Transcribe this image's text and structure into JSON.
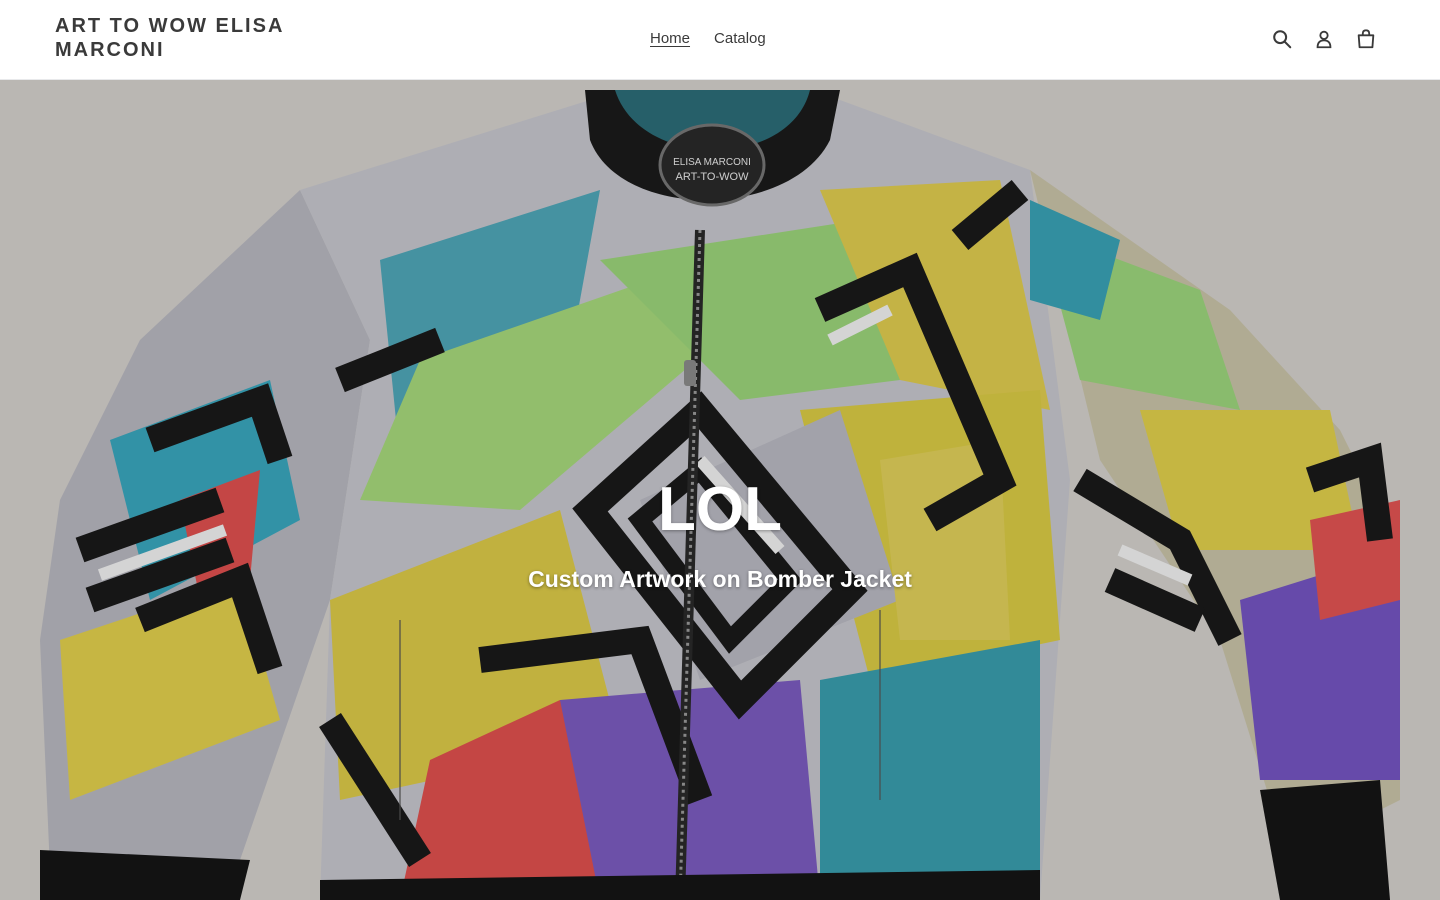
{
  "header": {
    "logo": "ART TO WOW ELISA MARCONI",
    "nav": [
      {
        "label": "Home",
        "active": true
      },
      {
        "label": "Catalog",
        "active": false
      }
    ],
    "icons": [
      "search-icon",
      "account-icon",
      "cart-icon"
    ]
  },
  "hero": {
    "title": "LOL",
    "subtitle": "Custom Artwork on Bomber Jacket",
    "collar_tag": {
      "line1": "ELISA MARCONI",
      "line2": "ART-TO-WOW"
    }
  },
  "colors": {
    "text": "#3a3a3a",
    "background": "#ffffff",
    "hero_text": "#ffffff"
  }
}
